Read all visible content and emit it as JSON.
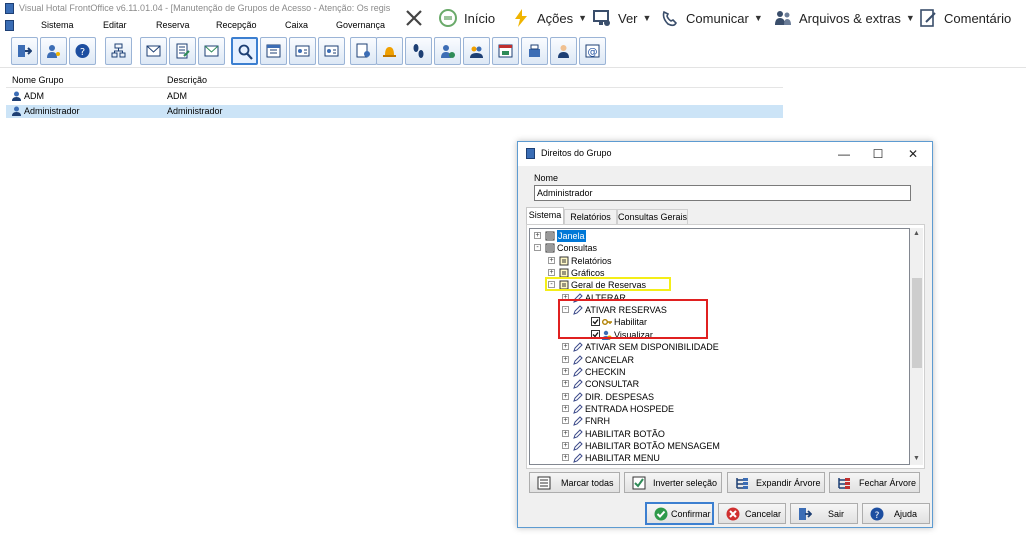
{
  "window": {
    "title": "Visual Hotal FrontOffice v6.11.01.04 - [Manutenção de Grupos de Acesso - Atenção: Os regis"
  },
  "menu": [
    "Sistema",
    "Editar",
    "Reserva",
    "Recepção",
    "Caixa",
    "Governança"
  ],
  "command_bar": {
    "close_icon": "close-icon",
    "items": [
      {
        "label": "Início",
        "icon": "home-icon",
        "has_caret": false
      },
      {
        "label": "Ações",
        "icon": "lightning-icon",
        "has_caret": true
      },
      {
        "label": "Ver",
        "icon": "monitor-icon",
        "has_caret": true
      },
      {
        "label": "Comunicar",
        "icon": "phone-icon",
        "has_caret": true
      },
      {
        "label": "Arquivos & extras",
        "icon": "people-icon",
        "has_caret": true
      },
      {
        "label": "Comentário",
        "icon": "comment-icon",
        "has_caret": false
      }
    ]
  },
  "toolbar": {
    "buttons": [
      "exit-icon",
      "user-key-icon",
      "help-icon",
      "org-chart-icon",
      "envelope-icon",
      "calculator-icon",
      "mail-send-icon",
      "search-icon",
      "calendar-icon",
      "id-card-icon",
      "id-card-icon",
      "guest-report-icon",
      "bell-icon",
      "footprints-icon",
      "add-user-icon",
      "group-icon",
      "cash-register-icon",
      "register-icon",
      "maid-icon",
      "email-at-icon"
    ],
    "active_index": 7
  },
  "list": {
    "columns": [
      "Nome Grupo",
      "Descrição"
    ],
    "rows": [
      {
        "name": "ADM",
        "description": "ADM",
        "selected": false
      },
      {
        "name": "Administrador",
        "description": "Administrador",
        "selected": true
      }
    ]
  },
  "dialog": {
    "title": "Direitos do Grupo",
    "name_label": "Nome",
    "name_value": "Administrador",
    "tabs": [
      "Sistema",
      "Relatórios",
      "Consultas Gerais"
    ],
    "active_tab": 0,
    "tree": [
      {
        "label": "Janela",
        "level": 0,
        "expander": "+",
        "icon": "book",
        "highlight": true
      },
      {
        "label": "Consultas",
        "level": 0,
        "expander": "-",
        "icon": "book",
        "highlight": false
      },
      {
        "label": "Relatórios",
        "level": 1,
        "expander": "+",
        "icon": "page",
        "highlight": false
      },
      {
        "label": "Gráficos",
        "level": 1,
        "expander": "+",
        "icon": "page",
        "highlight": false
      },
      {
        "label": "Geral de Reservas",
        "level": 1,
        "expander": "-",
        "icon": "page",
        "highlight": false
      },
      {
        "label": "ALTERAR",
        "level": 2,
        "expander": "+",
        "icon": "pen",
        "highlight": false
      },
      {
        "label": "ATIVAR RESERVAS",
        "level": 2,
        "expander": "-",
        "icon": "pen",
        "highlight": false
      },
      {
        "label": "Habilitar",
        "level": 3,
        "expander": "",
        "icon": "key",
        "checked": true,
        "highlight": false
      },
      {
        "label": "Visualizar",
        "level": 3,
        "expander": "",
        "icon": "eye",
        "checked": true,
        "highlight": false
      },
      {
        "label": "ATIVAR SEM DISPONIBILIDADE",
        "level": 2,
        "expander": "+",
        "icon": "pen",
        "highlight": false
      },
      {
        "label": "CANCELAR",
        "level": 2,
        "expander": "+",
        "icon": "pen",
        "highlight": false
      },
      {
        "label": "CHECKIN",
        "level": 2,
        "expander": "+",
        "icon": "pen",
        "highlight": false
      },
      {
        "label": "CONSULTAR",
        "level": 2,
        "expander": "+",
        "icon": "pen",
        "highlight": false
      },
      {
        "label": "DIR. DESPESAS",
        "level": 2,
        "expander": "+",
        "icon": "pen",
        "highlight": false
      },
      {
        "label": "ENTRADA HOSPEDE",
        "level": 2,
        "expander": "+",
        "icon": "pen",
        "highlight": false
      },
      {
        "label": "FNRH",
        "level": 2,
        "expander": "+",
        "icon": "pen",
        "highlight": false
      },
      {
        "label": "HABILITAR BOTÃO",
        "level": 2,
        "expander": "+",
        "icon": "pen",
        "highlight": false
      },
      {
        "label": "HABILITAR BOTÃO MENSAGEM",
        "level": 2,
        "expander": "+",
        "icon": "pen",
        "highlight": false
      },
      {
        "label": "HABILITAR MENU",
        "level": 2,
        "expander": "+",
        "icon": "pen",
        "highlight": false
      },
      {
        "label": "",
        "level": 2,
        "expander": "+",
        "icon": "pen",
        "highlight": false
      }
    ],
    "action_buttons": [
      "Marcar todas",
      "Inverter seleção",
      "Expandir Árvore",
      "Fechar Árvore"
    ],
    "footer_buttons": [
      "Confirmar",
      "Cancelar",
      "Sair",
      "Ajuda"
    ],
    "annotation_colors": {
      "yellow": "#f4ee18",
      "red": "#e02020"
    }
  }
}
